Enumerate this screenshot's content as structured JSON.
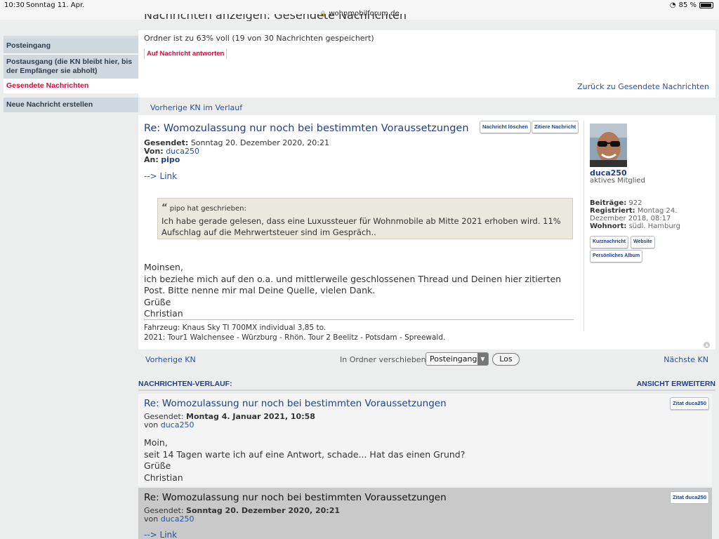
{
  "status_bar": {
    "time": "10:30",
    "date": "Sonntag 11. Apr.",
    "url": "wohnmobilforum.de",
    "battery": "85 %"
  },
  "header": {
    "cut_title": "Nachrichten anzeigen: Gesendete Nachrichten"
  },
  "sidebar": {
    "items": [
      {
        "label": "Posteingang"
      },
      {
        "label": "Postausgang (die KN bleibt hier, bis der Empfänger sie abholt)"
      },
      {
        "label": "Gesendete Nachrichten"
      },
      {
        "label": "Neue Nachricht erstellen"
      }
    ]
  },
  "info": {
    "folder_status": "Ordner ist zu 63% voll (19 von 30 Nachrichten gespeichert)",
    "reply_label": "Auf Nachricht antworten",
    "back_label": "Zurück zu Gesendete Nachrichten"
  },
  "prev_history_label": "Vorherige KN im Verlauf",
  "message": {
    "title": "Re: Womozulassung nur noch bei bestimmten Voraussetzungen",
    "delete_label": "Nachricht löschen",
    "quote_label": "Zitiere Nachricht",
    "sent_label": "Gesendet:",
    "sent_value": "Sonntag 20. Dezember 2020, 20:21",
    "from_label": "Von:",
    "from_value": "duca250",
    "to_label": "An:",
    "to_value": "pipo",
    "link_text": "--> Link",
    "quote": {
      "author": "pipo hat geschrieben:",
      "text": "Ich habe gerade gelesen, dass eine Luxussteuer für Wohnmobile ab Mitte 2021 erhoben wird. 11% Aufschlag auf die Mehrwertsteuer sind im Gespräch.."
    },
    "body_lines": [
      "Moinsen,",
      "ich beziehe mich auf den o.a. und mittlerweile geschlossenen Thread und Deinen hier zitierten Post. Bitte nenne mir mal Deine Quelle, vielen Dank.",
      "Grüße",
      "Christian"
    ],
    "signature_lines": [
      "Fahrzeug: Knaus Sky TI 700MX individual 3,85 to.",
      "2021: Tour1 Walchensee - Würzburg - Rhön. Tour 2 Beelitz - Potsdam - Spreewald."
    ]
  },
  "profile": {
    "username": "duca250",
    "rank": "aktives Mitglied",
    "posts_label": "Beiträge:",
    "posts_value": "922",
    "registered_label": "Registriert:",
    "registered_value": "Montag 24. Dezember 2018, 08:17",
    "location_label": "Wohnort:",
    "location_value": "südl. Hamburg",
    "pm_label": "Kurznachricht",
    "website_label": "Website",
    "album_label": "Persönliches Album"
  },
  "nav": {
    "prev_label": "Vorherige KN",
    "move_label": "In Ordner verschieben:",
    "move_selected": "Posteingang",
    "go_label": "Los",
    "next_label": "Nächste KN"
  },
  "history": {
    "heading": "NACHRICHTEN-VERLAUF:",
    "expand_label": "ANSICHT ERWEITERN",
    "items": [
      {
        "title": "Re: Womozulassung nur noch bei bestimmten Voraussetzungen",
        "sent_label": "Gesendet:",
        "sent_value": "Montag 4. Januar 2021, 10:58",
        "from_label": "von",
        "from_value": "duca250",
        "quote_label": "Zitat duca250",
        "body_lines": [
          "Moin,",
          "seit 14 Tagen warte ich auf eine Antwort, schade... Hat das einen Grund?",
          "Grüße",
          "Christian"
        ]
      },
      {
        "title": "Re: Womozulassung nur noch bei bestimmten Voraussetzungen",
        "sent_label": "Gesendet:",
        "sent_value": "Sonntag 20. Dezember 2020, 20:21",
        "from_label": "von",
        "from_value": "duca250",
        "quote_label": "Zitat duca250",
        "link_text": "--> Link"
      }
    ]
  }
}
